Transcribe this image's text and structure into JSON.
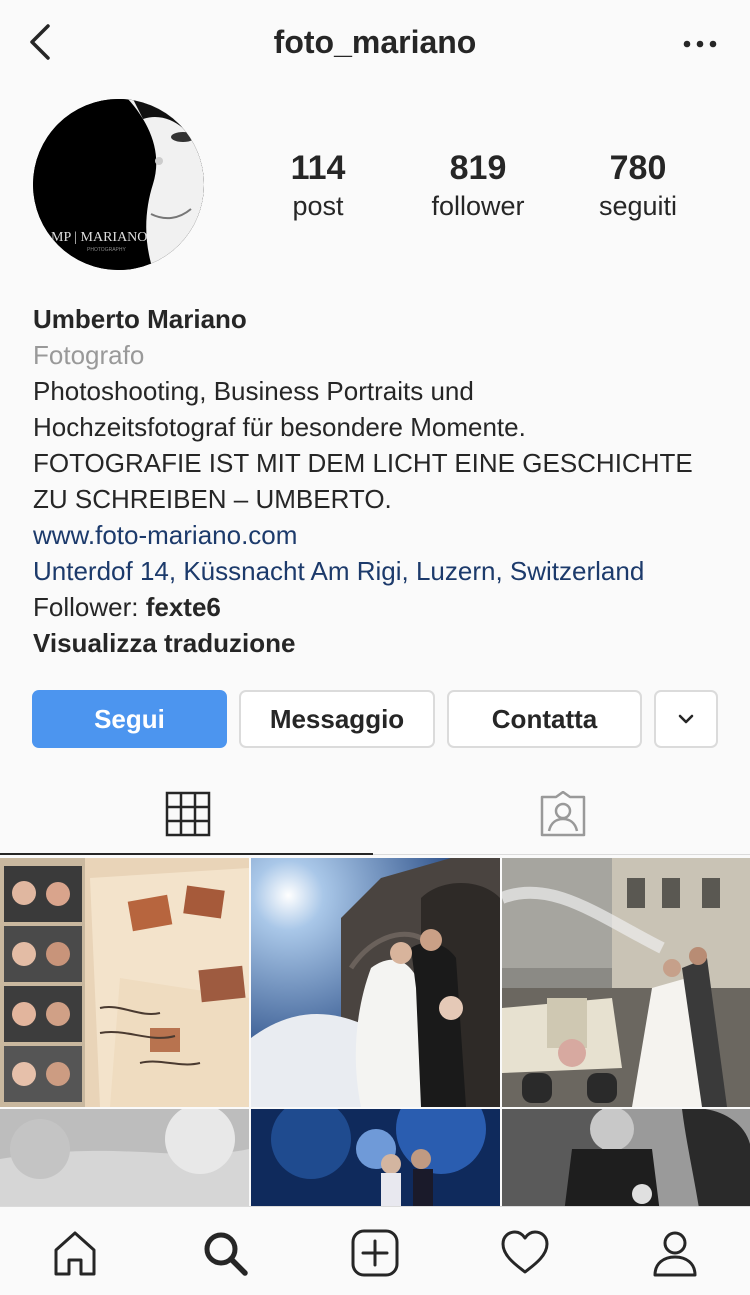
{
  "header": {
    "username": "foto_mariano",
    "back_icon": "chevron-left-icon",
    "more_icon": "more-horizontal-icon"
  },
  "profile": {
    "avatar_text": "MP | MARIANO",
    "avatar_subtext": "PHOTOGRAPHY"
  },
  "stats": [
    {
      "value": "114",
      "label": "post"
    },
    {
      "value": "819",
      "label": "follower"
    },
    {
      "value": "780",
      "label": "seguiti"
    }
  ],
  "bio": {
    "name": "Umberto Mariano",
    "category": "Fotografo",
    "lines": [
      "Photoshooting, Business Portraits und",
      "Hochzeitsfotograf für besondere Momente.",
      "FOTOGRAFIE IST MIT DEM LICHT EINE GESCHICHTE",
      "ZU SCHREIBEN – UMBERTO."
    ],
    "website": "www.foto-mariano.com",
    "address": "Unterdof 14, Küssnacht Am Rigi, Luzern, Switzerland",
    "followed_by_prefix": "Follower: ",
    "followed_by_user": "fexte6",
    "translate": "Visualizza traduzione"
  },
  "actions": {
    "follow": "Segui",
    "message": "Messaggio",
    "contact": "Contatta",
    "dropdown_icon": "chevron-down-icon"
  },
  "tabs": [
    {
      "icon": "grid-icon",
      "active": true
    },
    {
      "icon": "tagged-icon",
      "active": false
    }
  ],
  "grid": [
    "photobooth-guestbook-photo",
    "wedding-kiss-cathedral-photo",
    "wedding-vintage-car-photo",
    "foggy-landscape-photo",
    "night-couple-photo",
    "couple-laughing-bw-photo"
  ],
  "tabbar": [
    "home-icon",
    "search-icon",
    "add-post-icon",
    "activity-heart-icon",
    "profile-icon"
  ],
  "colors": {
    "follow_button": "#4c95ef",
    "link": "#1c3a6b",
    "secondary_text": "#999999",
    "border": "#dbdbdb"
  }
}
